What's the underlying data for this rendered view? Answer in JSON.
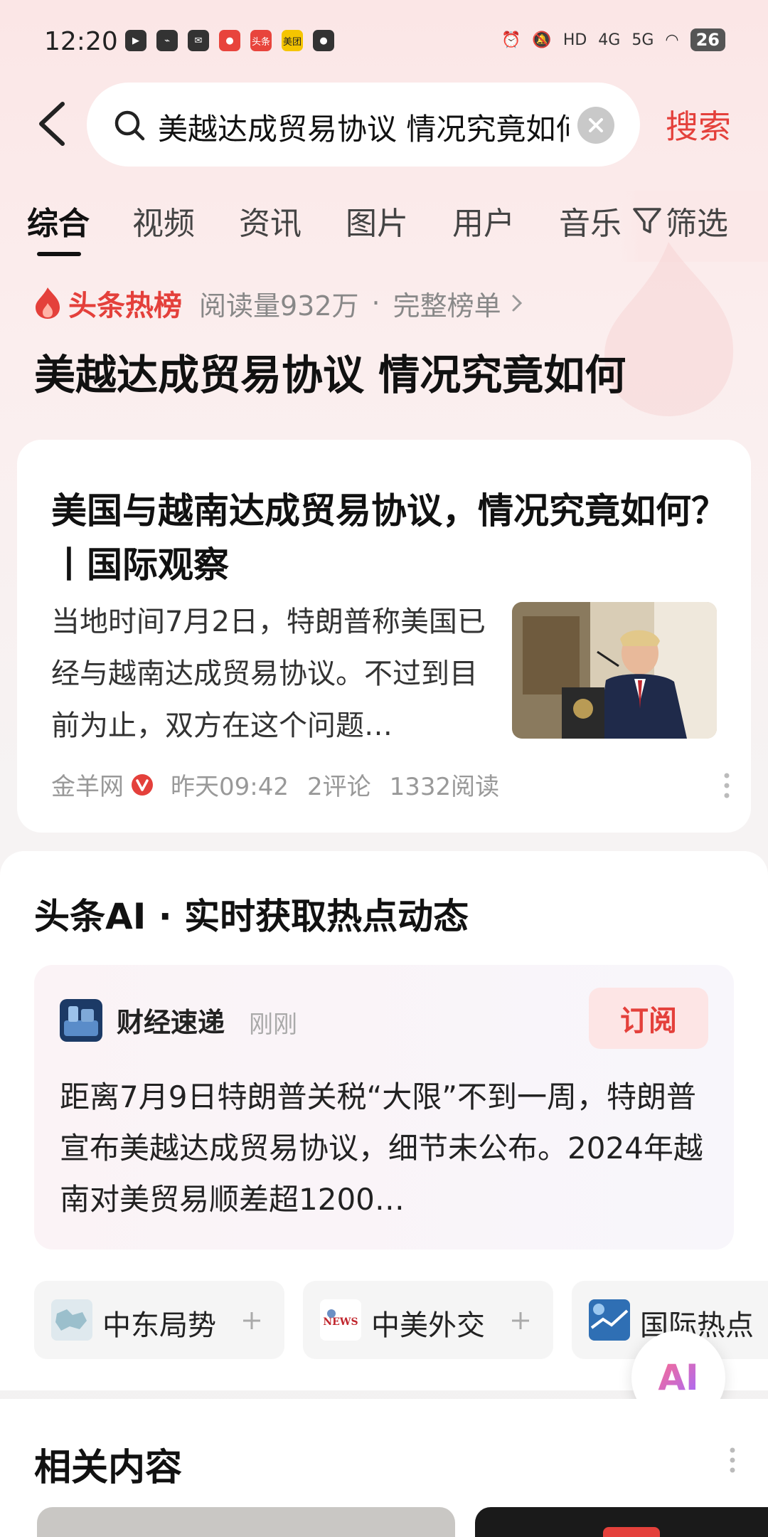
{
  "status_bar": {
    "time": "12:20",
    "network_labels": [
      "HD",
      "4G",
      "5G"
    ],
    "battery": "26",
    "app_labels": [
      "头条",
      "美团"
    ]
  },
  "search": {
    "query": "美越达成贸易协议 情况究竟如何",
    "submit_label": "搜索"
  },
  "tabs": [
    {
      "label": "综合",
      "active": true
    },
    {
      "label": "视频",
      "active": false
    },
    {
      "label": "资讯",
      "active": false
    },
    {
      "label": "图片",
      "active": false
    },
    {
      "label": "用户",
      "active": false
    },
    {
      "label": "音乐",
      "active": false
    }
  ],
  "filter_label": "筛选",
  "hot": {
    "badge": "头条热榜",
    "reads": "阅读量932万",
    "separator": "·",
    "full_list": "完整榜单",
    "headline": "美越达成贸易协议 情况究竟如何"
  },
  "news_card": {
    "title": "美国与越南达成贸易协议，情况究竟如何？丨国际观察",
    "summary": "当地时间7月2日，特朗普称美国已经与越南达成贸易协议。不过到目前为止，双方在这个问题…",
    "source": "金羊网",
    "time": "昨天09:42",
    "comments": "2评论",
    "reads": "1332阅读"
  },
  "ai_section": {
    "title": "头条AI · 实时获取热点动态",
    "card": {
      "source": "财经速递",
      "time": "刚刚",
      "subscribe_label": "订阅",
      "text": "距离7月9日特朗普关税“大限”不到一周，特朗普宣布美越达成贸易协议，细节未公布。2024年越南对美贸易顺差超1200…"
    },
    "chips": [
      {
        "label": "中东局势"
      },
      {
        "label": "中美外交"
      },
      {
        "label": "国际热点"
      }
    ]
  },
  "ai_fab_label": "AI",
  "related": {
    "title": "相关内容"
  },
  "colors": {
    "accent": "#e4403b",
    "subscribe_bg": "#fde5e5"
  }
}
